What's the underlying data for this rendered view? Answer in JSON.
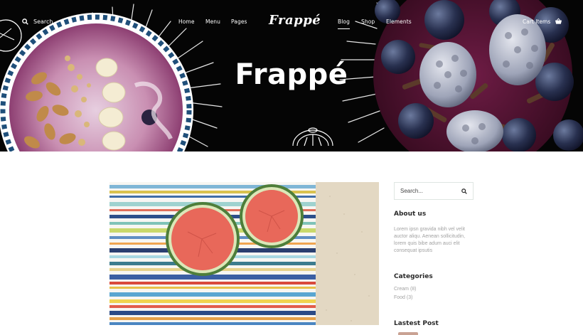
{
  "nav": {
    "search_label": "Search",
    "links": [
      "Home",
      "Menu",
      "Pages",
      "Blog",
      "Shop",
      "Elements"
    ],
    "active_link": "Blog",
    "logo": "Frappé",
    "cart_label": "Cart Items"
  },
  "hero": {
    "title": "Frappé"
  },
  "sidebar": {
    "search_placeholder": "Search...",
    "about": {
      "title": "About us",
      "text": "Lorem ipsn gravida nibh vel velit auctor aliqu. Aenean sollicitudin, lorem quis bibe adum auci elit consequat ipsutis"
    },
    "categories": {
      "title": "Categories",
      "items": [
        "Cream (8)",
        "Food (3)"
      ]
    },
    "latest_post": {
      "title": "Lastest Post"
    }
  },
  "colors": {
    "hero_bg": "#050505",
    "accent_border": "#dfe6e2",
    "muted_text": "#a2a2a2"
  }
}
